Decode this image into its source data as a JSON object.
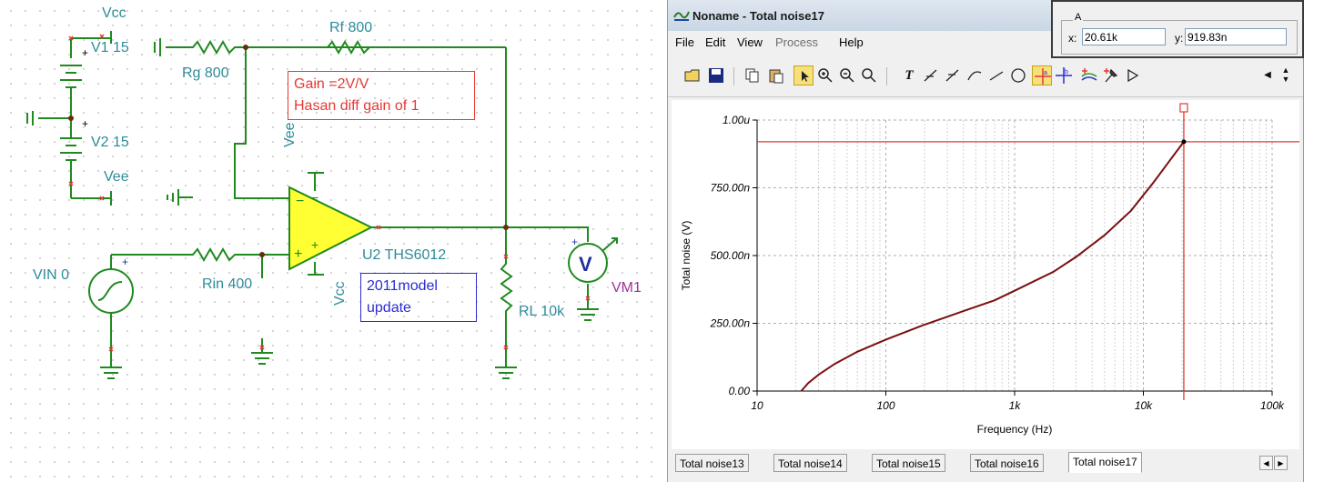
{
  "schematic": {
    "labels": {
      "vcc_top": "Vcc",
      "v1": "V1 15",
      "v2": "V2 15",
      "vee_left": "Vee",
      "rg": "Rg 800",
      "rf": "Rf 800",
      "rin": "Rin 400",
      "vin": "VIN 0",
      "vee_opamp": "Vee",
      "vcc_opamp": "Vcc",
      "opamp": "U2 THS6012",
      "rl": "RL 10k",
      "vm": "VM1"
    },
    "note_red": [
      "Gain =2V/V",
      "Hasan diff gain of 1"
    ],
    "note_blue": [
      "2011model",
      "update"
    ],
    "colors": {
      "wire": "#1f8a1f",
      "label": "#2e8b9a",
      "opamp_fill": "#ffff33",
      "accent_red": "#e53935",
      "accent_blue": "#2b2bd6"
    }
  },
  "window": {
    "title": "Noname - Total noise17",
    "menu": [
      "File",
      "Edit",
      "View",
      "Process",
      "Help"
    ],
    "toolbar_icons": [
      "open-folder-icon",
      "save-icon",
      "copy-icon",
      "paste-icon",
      "pointer-icon",
      "zoom-in-icon",
      "zoom-out-icon",
      "zoom-100-icon",
      "text-tool-icon",
      "cursor-icon",
      "line-icon",
      "circle-icon",
      "cursor-a-icon",
      "cursor-b-icon",
      "add-marker-icon",
      "pin-icon"
    ],
    "tabs": [
      "Total noise13",
      "Total noise14",
      "Total noise15",
      "Total noise16",
      "Total noise17"
    ],
    "active_tab": "Total noise17"
  },
  "cursor_readout": {
    "group": "A",
    "x_label": "x:",
    "x_value": "20.61k",
    "y_label": "y:",
    "y_value": "919.83n"
  },
  "chart_data": {
    "type": "line",
    "xlabel": "Frequency (Hz)",
    "ylabel": "Total noise (V)",
    "x_scale": "log",
    "xlim": [
      10,
      100000
    ],
    "ylim": [
      0,
      1e-06
    ],
    "x_ticks": [
      "10",
      "100",
      "1k",
      "10k",
      "100k"
    ],
    "y_ticks": [
      "0.00",
      "250.00n",
      "500.00n",
      "750.00n",
      "1.00u"
    ],
    "grid": true,
    "series": [
      {
        "color": "#7a1010",
        "x": [
          22,
          25,
          30,
          40,
          60,
          100,
          200,
          400,
          700,
          1000,
          2000,
          3000,
          5000,
          8000,
          12000,
          16000,
          20610
        ],
        "y": [
          0,
          3e-08,
          6e-08,
          1e-07,
          1.45e-07,
          1.9e-07,
          2.45e-07,
          2.95e-07,
          3.35e-07,
          3.7e-07,
          4.4e-07,
          4.95e-07,
          5.75e-07,
          6.65e-07,
          7.7e-07,
          8.5e-07,
          9.1983e-07
        ]
      }
    ],
    "cursor": {
      "x": 20610,
      "y": 9.1983e-07,
      "color": "#e53935"
    }
  }
}
